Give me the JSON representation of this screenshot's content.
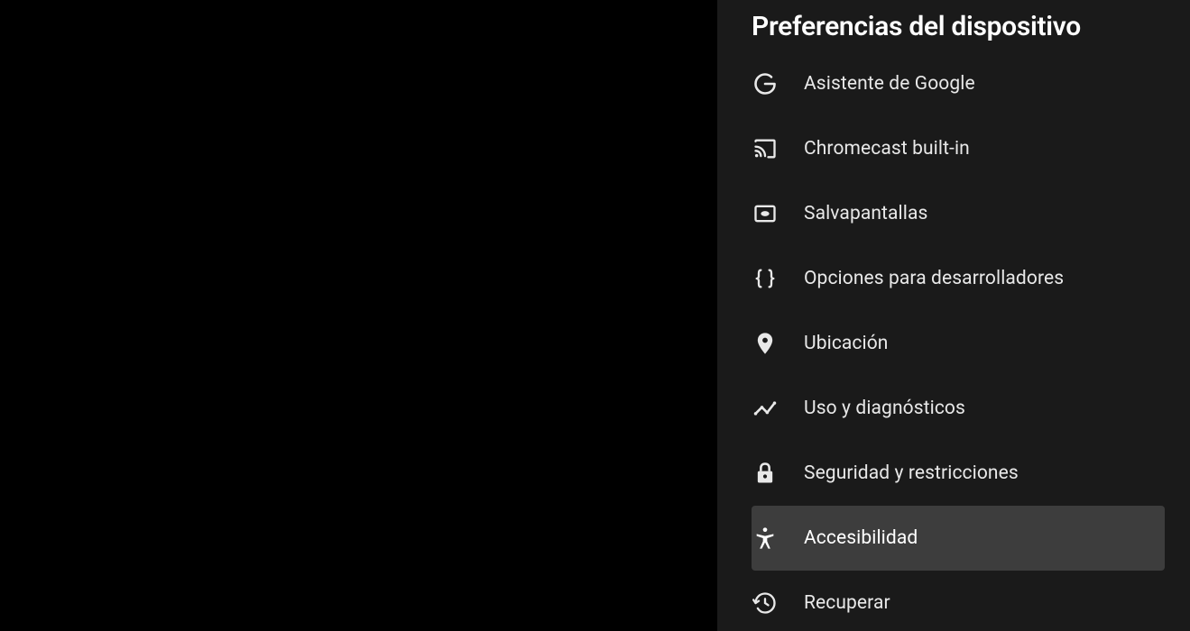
{
  "panel": {
    "title": "Preferencias del dispositivo"
  },
  "menu": {
    "items": [
      {
        "label": "Asistente de Google",
        "icon": "google-icon",
        "selected": false
      },
      {
        "label": "Chromecast built-in",
        "icon": "cast-icon",
        "selected": false
      },
      {
        "label": "Salvapantallas",
        "icon": "screensaver-icon",
        "selected": false
      },
      {
        "label": "Opciones para desarrolladores",
        "icon": "braces-icon",
        "selected": false
      },
      {
        "label": "Ubicación",
        "icon": "location-icon",
        "selected": false
      },
      {
        "label": "Uso y diagnósticos",
        "icon": "chart-icon",
        "selected": false
      },
      {
        "label": "Seguridad y restricciones",
        "icon": "lock-icon",
        "selected": false
      },
      {
        "label": "Accesibilidad",
        "icon": "accessibility-icon",
        "selected": true
      },
      {
        "label": "Recuperar",
        "icon": "restore-icon",
        "selected": false
      }
    ]
  }
}
